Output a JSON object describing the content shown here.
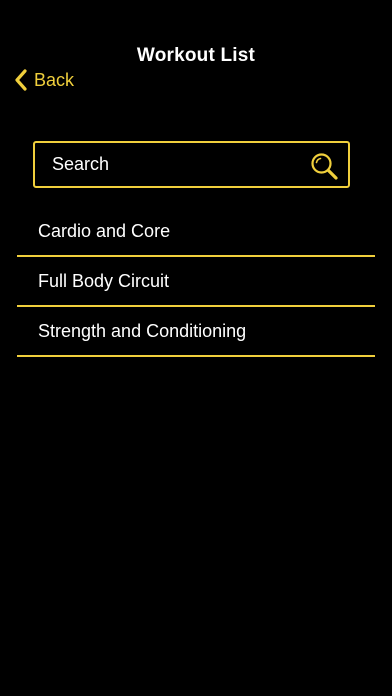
{
  "header": {
    "title": "Workout List",
    "back_label": "Back"
  },
  "search": {
    "placeholder": "Search",
    "value": ""
  },
  "workouts": [
    {
      "label": "Cardio and Core"
    },
    {
      "label": "Full Body Circuit"
    },
    {
      "label": "Strength and Conditioning"
    }
  ],
  "icons": {
    "back": "chevron-left-icon",
    "search": "magnifier-icon"
  },
  "colors": {
    "background": "#000000",
    "accent": "#f0cf3c",
    "text": "#ffffff"
  }
}
